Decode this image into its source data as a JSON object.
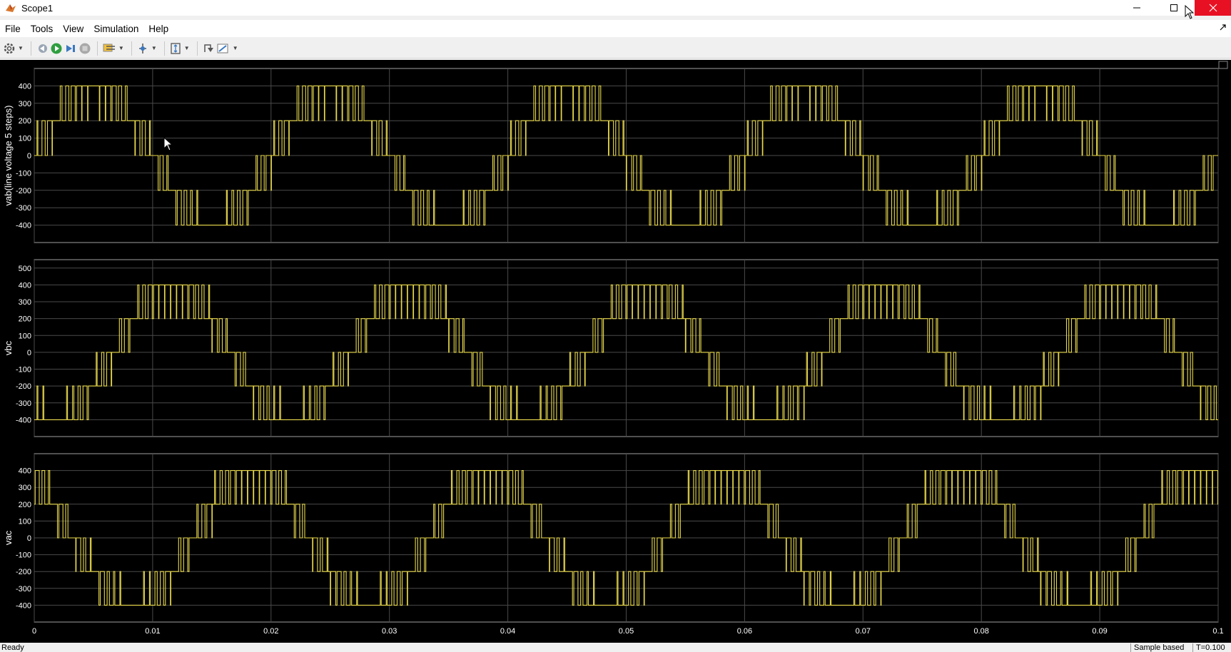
{
  "window": {
    "title": "Scope1"
  },
  "menu": {
    "items": [
      "File",
      "Tools",
      "View",
      "Simulation",
      "Help"
    ]
  },
  "toolbar": {
    "icons": [
      "gear-icon",
      "step-back-icon",
      "run-icon",
      "step-forward-icon",
      "stop-icon",
      "highlight-icon",
      "trigger-icon",
      "scale-icon",
      "restore-icon",
      "style-icon"
    ]
  },
  "colors": {
    "signal": "#e8d84a",
    "background": "#000000",
    "grid": "#4a4a4a",
    "frame": "#a0a0a0"
  },
  "chart_data": [
    {
      "type": "line",
      "ylabel": "vab(line voltage 5 steps)",
      "xlim": [
        0,
        0.1
      ],
      "ylim": [
        -500,
        500
      ],
      "yticks": [
        -400,
        -300,
        -200,
        -100,
        0,
        100,
        200,
        300,
        400
      ],
      "phase_deg": 0,
      "step_levels": [
        -400,
        -200,
        0,
        200,
        400
      ],
      "frequency_hz": 50
    },
    {
      "type": "line",
      "ylabel": "vbc",
      "xlim": [
        0,
        0.1
      ],
      "ylim": [
        -500,
        500
      ],
      "yticks": [
        -400,
        -300,
        -200,
        -100,
        0,
        100,
        200,
        300,
        400,
        500
      ],
      "phase_deg": -120,
      "step_levels": [
        -400,
        -200,
        0,
        200,
        400
      ],
      "frequency_hz": 50
    },
    {
      "type": "line",
      "ylabel": "vac",
      "xlim": [
        0,
        0.1
      ],
      "ylim": [
        -500,
        500
      ],
      "yticks": [
        -400,
        -300,
        -200,
        -100,
        0,
        100,
        200,
        300,
        400
      ],
      "phase_deg": 120,
      "step_levels": [
        -400,
        -200,
        0,
        200,
        400
      ],
      "frequency_hz": 50
    }
  ],
  "xaxis": {
    "ticks": [
      "0",
      "0.01",
      "0.02",
      "0.03",
      "0.04",
      "0.05",
      "0.06",
      "0.07",
      "0.08",
      "0.09",
      "0.1"
    ]
  },
  "status": {
    "left": "Ready",
    "mode": "Sample based",
    "time": "T=0.100"
  }
}
